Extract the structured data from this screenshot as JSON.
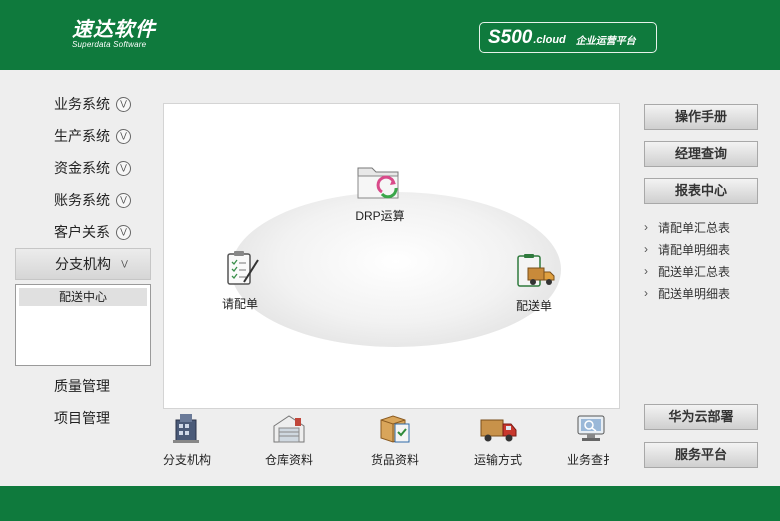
{
  "header": {
    "logo_main": "速达软件",
    "logo_sub": "Superdata Software",
    "product_code": "S500",
    "product_cloud": ".cloud",
    "product_name": "企业运营平台"
  },
  "left_menu": {
    "items": [
      {
        "label": "业务系统"
      },
      {
        "label": "生产系统"
      },
      {
        "label": "资金系统"
      },
      {
        "label": "账务系统"
      },
      {
        "label": "客户关系"
      }
    ],
    "active": {
      "label": "分支机构"
    },
    "submenu": [
      {
        "label": "配送中心"
      }
    ],
    "bottom_items": [
      {
        "label": "质量管理"
      },
      {
        "label": "项目管理"
      }
    ]
  },
  "diagram": {
    "nodes": [
      {
        "label": "DRP运算",
        "icon": "folder-refresh-icon"
      },
      {
        "label": "请配单",
        "icon": "clipboard-pen-icon"
      },
      {
        "label": "配送单",
        "icon": "delivery-truck-icon"
      }
    ]
  },
  "toolbar": [
    {
      "label": "分支机构",
      "icon": "branch-building-icon"
    },
    {
      "label": "仓库资料",
      "icon": "warehouse-icon"
    },
    {
      "label": "货品资料",
      "icon": "goods-box-icon"
    },
    {
      "label": "运输方式",
      "icon": "truck-icon"
    },
    {
      "label": "业务查扌",
      "icon": "monitor-search-icon"
    }
  ],
  "right": {
    "buttons": [
      {
        "label": "操作手册"
      },
      {
        "label": "经理查询"
      },
      {
        "label": "报表中心"
      }
    ],
    "reports": [
      {
        "label": "请配单汇总表"
      },
      {
        "label": "请配单明细表"
      },
      {
        "label": "配送单汇总表"
      },
      {
        "label": "配送单明细表"
      }
    ],
    "bottom_buttons": [
      {
        "label": "华为云部署"
      },
      {
        "label": "服务平台"
      }
    ]
  },
  "colors": {
    "brand_green": "#0f7a3d"
  }
}
